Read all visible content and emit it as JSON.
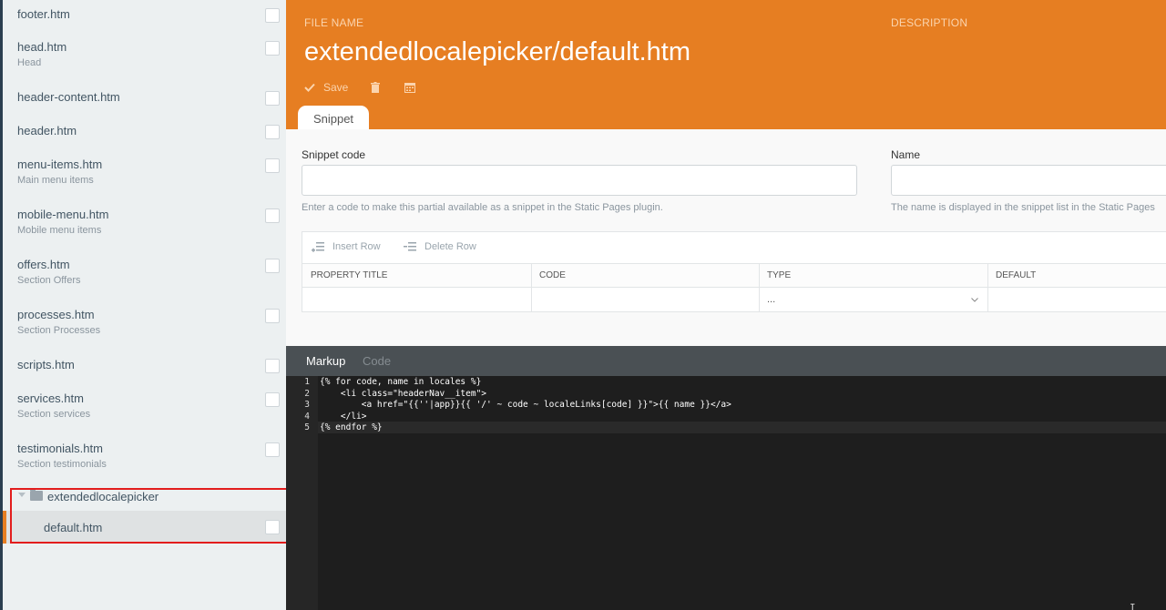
{
  "sidebar": {
    "files": [
      {
        "name": "footer.htm",
        "description": ""
      },
      {
        "name": "head.htm",
        "description": "Head"
      },
      {
        "name": "header-content.htm",
        "description": ""
      },
      {
        "name": "header.htm",
        "description": ""
      },
      {
        "name": "menu-items.htm",
        "description": "Main menu items"
      },
      {
        "name": "mobile-menu.htm",
        "description": "Mobile menu items"
      },
      {
        "name": "offers.htm",
        "description": "Section Offers"
      },
      {
        "name": "processes.htm",
        "description": "Section Processes"
      },
      {
        "name": "scripts.htm",
        "description": ""
      },
      {
        "name": "services.htm",
        "description": "Section services"
      },
      {
        "name": "testimonials.htm",
        "description": "Section testimonials"
      }
    ],
    "folder": {
      "name": "extendedlocalepicker"
    },
    "selected_file": {
      "name": "default.htm"
    }
  },
  "header": {
    "file_name_label": "FILE NAME",
    "description_label": "DESCRIPTION",
    "title": "extendedlocalepicker/default.htm",
    "save_label": "Save",
    "tab_label": "Snippet"
  },
  "form": {
    "snippet_code_label": "Snippet code",
    "snippet_code_value": "",
    "snippet_code_help": "Enter a code to make this partial available as a snippet in the Static Pages plugin.",
    "name_label": "Name",
    "name_value": "",
    "name_help": "The name is displayed in the snippet list in the Static Pages",
    "insert_row_label": "Insert Row",
    "delete_row_label": "Delete Row",
    "columns": [
      "PROPERTY TITLE",
      "CODE",
      "TYPE",
      "DEFAULT"
    ],
    "row": {
      "property_title": "",
      "code": "",
      "type": "...",
      "default": ""
    }
  },
  "editor": {
    "tabs": [
      "Markup",
      "Code"
    ],
    "active_tab": "Markup",
    "line_numbers": [
      "1",
      "2",
      "3",
      "4",
      "5"
    ],
    "lines": [
      "{% for code, name in locales %}",
      "    <li class=\"headerNav__item\">",
      "        <a href=\"{{''|app}}{{ '/' ~ code ~ localeLinks[code] }}\">{{ name }}</a>",
      "    </li>",
      "{% endfor %}"
    ]
  },
  "colors": {
    "accent": "#e67e22",
    "sidebar_bg": "#ecf0f1",
    "highlight": "#e21d1d",
    "editor_bg": "#1e1e1e"
  }
}
